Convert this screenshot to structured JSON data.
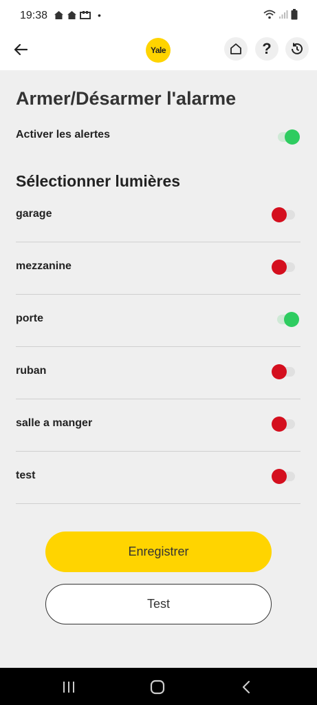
{
  "status": {
    "time": "19:38",
    "dot": "•"
  },
  "appbar": {
    "logo": "Yale",
    "help": "?"
  },
  "page": {
    "title": "Armer/Désarmer l'alarme",
    "alerts_label": "Activer les alertes",
    "alerts_on": true,
    "section_title": "Sélectionner lumières"
  },
  "lights": [
    {
      "label": "garage",
      "on": false
    },
    {
      "label": "mezzanine",
      "on": false
    },
    {
      "label": "porte",
      "on": true
    },
    {
      "label": "ruban",
      "on": false
    },
    {
      "label": "salle a manger",
      "on": false
    },
    {
      "label": "test",
      "on": false
    }
  ],
  "buttons": {
    "save": "Enregistrer",
    "test": "Test"
  },
  "colors": {
    "accent": "#ffd400",
    "on": "#2ecc60",
    "off": "#d40f1e"
  },
  "icons": [
    "back-arrow-icon",
    "home-icon",
    "help-icon",
    "history-icon",
    "wifi-icon",
    "signal-icon",
    "battery-icon"
  ]
}
